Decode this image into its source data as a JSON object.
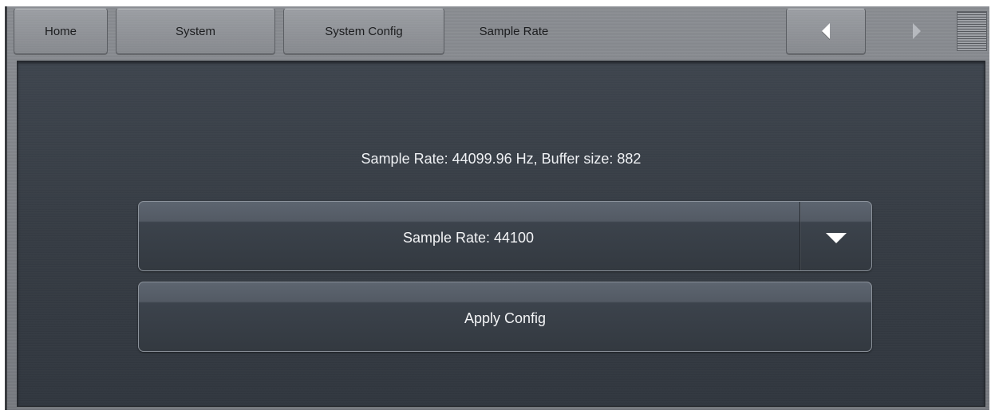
{
  "nav": {
    "home_label": "Home",
    "system_label": "System",
    "system_config_label": "System Config",
    "current_label": "Sample Rate"
  },
  "icons": {
    "back": "arrow-left-icon",
    "forward": "arrow-right-icon",
    "menu": "menu-icon",
    "dropdown": "chevron-down-icon"
  },
  "main": {
    "status": "Sample Rate: 44099.96 Hz, Buffer size: 882",
    "sample_rate_select": {
      "selected": "Sample Rate: 44100"
    },
    "apply_label": "Apply Config"
  },
  "colors": {
    "panel_bg": "#343a42",
    "topbar_bg": "#84878c",
    "text_light": "#eef0f3"
  }
}
